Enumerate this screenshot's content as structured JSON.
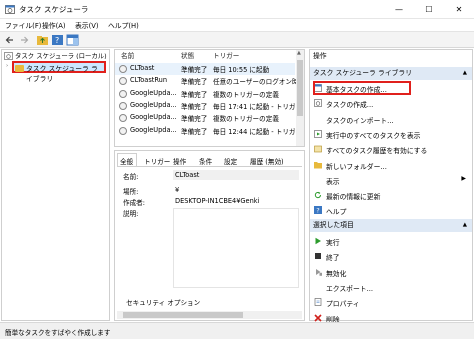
{
  "window": {
    "title": "タスク スケジューラ",
    "minimize": "—",
    "maximize": "☐",
    "close": "✕"
  },
  "menu": [
    "ファイル(F)",
    "操作(A)",
    "表示(V)",
    "ヘルプ(H)"
  ],
  "tree": {
    "root": "タスク スケジューラ (ローカル)",
    "library": "タスク スケジューラ ライブラリ"
  },
  "task_list": {
    "columns": [
      "名前",
      "状態",
      "トリガー"
    ],
    "rows": [
      {
        "name": "CLToast",
        "status": "準備完了",
        "trigger": "毎日 10:55 に起動"
      },
      {
        "name": "CLToastRun",
        "status": "準備完了",
        "trigger": "任意のユーザーのログオン時"
      },
      {
        "name": "GoogleUpda...",
        "status": "準備完了",
        "trigger": "複数のトリガーの定義"
      },
      {
        "name": "GoogleUpda...",
        "status": "準備完了",
        "trigger": "毎日 17:41 に起動 - トリガ"
      },
      {
        "name": "GoogleUpda...",
        "status": "準備完了",
        "trigger": "複数のトリガーの定義"
      },
      {
        "name": "GoogleUpda...",
        "status": "準備完了",
        "trigger": "毎日 12:44 に起動 - トリガ"
      }
    ]
  },
  "detail": {
    "tabs": [
      "全般",
      "トリガー",
      "操作",
      "条件",
      "設定",
      "履歴 (無効)"
    ],
    "fields": {
      "name_label": "名前:",
      "name_value": "CLToast",
      "location_label": "場所:",
      "location_value": "¥",
      "author_label": "作成者:",
      "author_value": "DESKTOP-IN1CBE4¥Genki",
      "description_label": "説明:"
    },
    "security_label": "セキュリティ オプション"
  },
  "actions": {
    "header": "操作",
    "section1": "タスク スケジューラ ライブラリ",
    "items1": [
      {
        "label": "基本タスクの作成...",
        "icon": "create-basic-task-icon"
      },
      {
        "label": "タスクの作成...",
        "icon": "create-task-icon"
      },
      {
        "label": "タスクのインポート...",
        "icon": ""
      },
      {
        "label": "実行中のすべてのタスクを表示",
        "icon": "running-tasks-icon"
      },
      {
        "label": "すべてのタスク履歴を有効にする",
        "icon": "history-icon"
      },
      {
        "label": "新しいフォルダー...",
        "icon": "folder-icon"
      },
      {
        "label": "表示",
        "icon": "",
        "submenu": "▶"
      },
      {
        "label": "最新の情報に更新",
        "icon": "refresh-icon"
      },
      {
        "label": "ヘルプ",
        "icon": "help-icon"
      }
    ],
    "section2": "選択した項目",
    "items2": [
      {
        "label": "実行",
        "icon": "run-icon"
      },
      {
        "label": "終了",
        "icon": "end-icon"
      },
      {
        "label": "無効化",
        "icon": "disable-icon"
      },
      {
        "label": "エクスポート...",
        "icon": ""
      },
      {
        "label": "プロパティ",
        "icon": "properties-icon"
      },
      {
        "label": "削除",
        "icon": "delete-icon"
      }
    ],
    "collapse": "▲"
  },
  "status": "簡単なタスクをすばやく作成します",
  "colors": {
    "selection": "#cce8ff",
    "highlight": "#e0201c",
    "section_bg": "#dfe9f5"
  }
}
